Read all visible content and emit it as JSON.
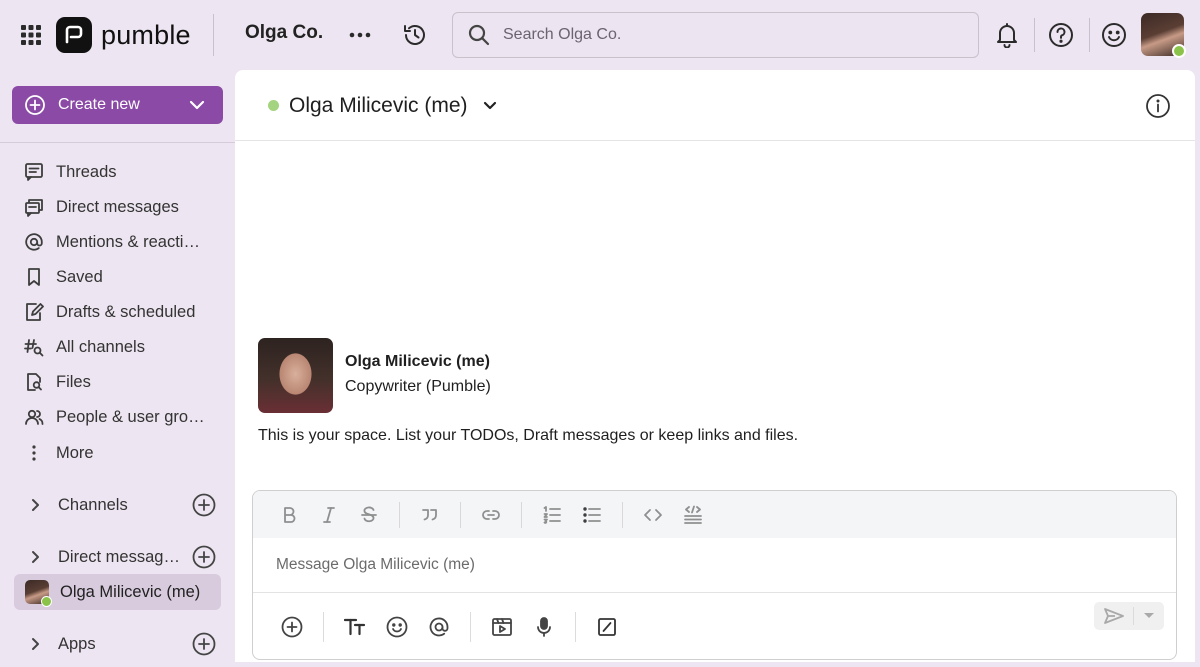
{
  "app": {
    "name": "pumble",
    "workspace": "Olga Co.",
    "accent": "#8a4aa6"
  },
  "search": {
    "placeholder": "Search Olga Co."
  },
  "sidebar": {
    "create_label": "Create new",
    "nav": [
      {
        "label": "Threads",
        "icon": "threads-icon"
      },
      {
        "label": "Direct messages",
        "icon": "direct-messages-icon"
      },
      {
        "label": "Mentions & reacti…",
        "icon": "at-icon"
      },
      {
        "label": "Saved",
        "icon": "bookmark-icon"
      },
      {
        "label": "Drafts & scheduled",
        "icon": "draft-icon"
      },
      {
        "label": "All channels",
        "icon": "channels-search-icon"
      },
      {
        "label": "Files",
        "icon": "file-search-icon"
      },
      {
        "label": "People & user gro…",
        "icon": "people-icon"
      },
      {
        "label": "More",
        "icon": "more-vertical-icon"
      }
    ],
    "sections": {
      "channels": "Channels",
      "direct_messages": "Direct messag…",
      "apps": "Apps"
    },
    "active_dm": "Olga Milicevic (me)"
  },
  "channel": {
    "title": "Olga Milicevic (me)",
    "status_color": "#a4d47f"
  },
  "profile": {
    "name": "Olga Milicevic (me)",
    "role": "Copywriter (Pumble)",
    "intro": "This is your space. List your TODOs, Draft messages or keep links and files."
  },
  "composer": {
    "placeholder": "Message Olga Milicevic (me)"
  }
}
